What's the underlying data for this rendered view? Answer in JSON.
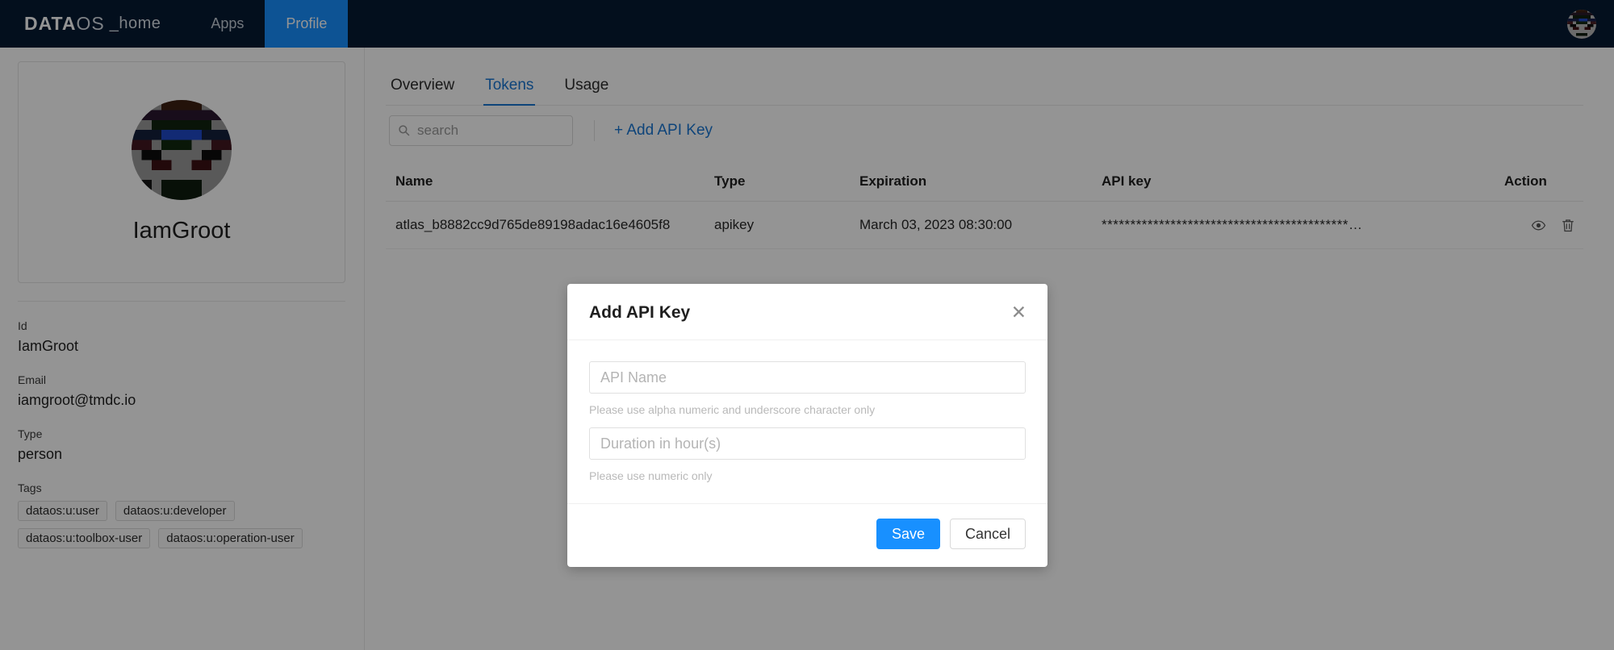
{
  "topnav": {
    "brand": {
      "bold": "DATA",
      "light": "OS",
      "suffix": "_home"
    },
    "items": [
      {
        "label": "Apps",
        "active": false
      },
      {
        "label": "Profile",
        "active": true
      }
    ],
    "avatar_icon": "user-avatar-identicon",
    "active_color": "#1890ff",
    "bg_color": "#061a33"
  },
  "sidebar": {
    "avatar_icon": "profile-avatar-identicon",
    "name": "IamGroot",
    "fields": [
      {
        "label": "Id",
        "value": "IamGroot"
      },
      {
        "label": "Email",
        "value": "iamgroot@tmdc.io"
      },
      {
        "label": "Type",
        "value": "person"
      }
    ],
    "tags_label": "Tags",
    "tags": [
      "dataos:u:user",
      "dataos:u:developer",
      "dataos:u:toolbox-user",
      "dataos:u:operation-user"
    ]
  },
  "main": {
    "tabs": [
      {
        "label": "Overview",
        "active": false
      },
      {
        "label": "Tokens",
        "active": true
      },
      {
        "label": "Usage",
        "active": false
      }
    ],
    "tab_active_color": "#1976d2",
    "search": {
      "placeholder": "search",
      "value": "",
      "icon": "search-icon"
    },
    "add_key_link": "+ Add API Key",
    "table": {
      "headers": [
        "Name",
        "Type",
        "Expiration",
        "API key",
        "Action"
      ],
      "rows": [
        {
          "name": "atlas_b8882cc9d765de89198adac16e4605f8",
          "type": "apikey",
          "expiration": "March 03, 2023 08:30:00",
          "api_key": "*******************************************…",
          "actions": [
            "eye-icon",
            "trash-icon"
          ]
        }
      ]
    }
  },
  "modal": {
    "title": "Add API Key",
    "close_icon": "close-icon",
    "fields": [
      {
        "placeholder": "API Name",
        "value": "",
        "help": "Please use alpha numeric and underscore character only"
      },
      {
        "placeholder": "Duration in hour(s)",
        "value": "",
        "help": "Please use numeric only"
      }
    ],
    "save_label": "Save",
    "cancel_label": "Cancel",
    "save_color": "#1890ff"
  }
}
